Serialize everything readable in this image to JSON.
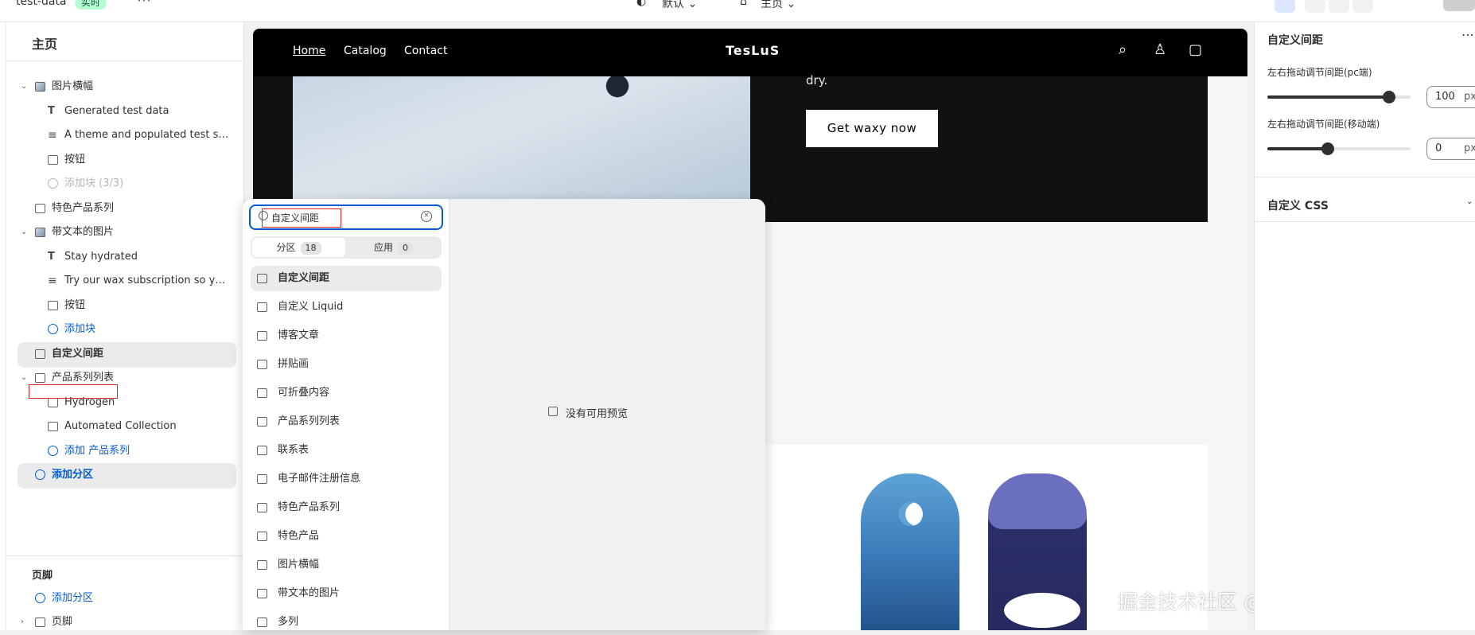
{
  "topbar": {
    "store_name": "test-data",
    "status_badge": "实时",
    "theme_selector": "默认",
    "page_selector": "主页"
  },
  "left_panel": {
    "title": "主页",
    "items": [
      {
        "label": "图片横幅",
        "icon": "image-icon",
        "level": 0,
        "chevron": true
      },
      {
        "label": "Generated test data",
        "icon": "text-icon",
        "level": 1
      },
      {
        "label": "A theme and populated test stor...",
        "icon": "lines-icon",
        "level": 1
      },
      {
        "label": "按钮",
        "icon": "button-icon",
        "level": 1
      },
      {
        "label": "添加块 (3/3)",
        "icon": "add-icon",
        "level": 1,
        "disabled": true
      },
      {
        "label": "特色产品系列",
        "icon": "section-icon",
        "level": 0
      },
      {
        "label": "带文本的图片",
        "icon": "image-icon",
        "level": 0,
        "chevron": true
      },
      {
        "label": "Stay hydrated",
        "icon": "text-icon",
        "level": 1
      },
      {
        "label": "Try our wax subscription so you...",
        "icon": "lines-icon",
        "level": 1
      },
      {
        "label": "按钮",
        "icon": "button-icon",
        "level": 1
      },
      {
        "label": "添加块",
        "icon": "add-icon",
        "level": 1,
        "blue": true
      },
      {
        "label": "自定义间距",
        "icon": "section-icon",
        "level": 0,
        "selected": true
      },
      {
        "label": "产品系列列表",
        "icon": "section-icon",
        "level": 0,
        "chevron": true
      },
      {
        "label": "Hydrogen",
        "icon": "frame-icon",
        "level": 1
      },
      {
        "label": "Automated Collection",
        "icon": "frame-icon",
        "level": 1
      },
      {
        "label": "添加 产品系列",
        "icon": "add-icon",
        "level": 1,
        "blue": true
      },
      {
        "label": "添加分区",
        "icon": "add-icon",
        "level": 0,
        "blue": true,
        "highlight": true
      }
    ],
    "footer_title": "页脚",
    "footer_add": "添加分区",
    "footer_item": "页脚"
  },
  "storefront": {
    "nav": [
      "Home",
      "Catalog",
      "Contact"
    ],
    "brand": "TesLuS",
    "hero_text": "dry.",
    "cta": "Get waxy now"
  },
  "picker": {
    "search_value": "自定义间距",
    "tabs": [
      {
        "label": "分区",
        "count": "18"
      },
      {
        "label": "应用",
        "count": "0"
      }
    ],
    "options": [
      "自定义间距",
      "自定义 Liquid",
      "博客文章",
      "拼贴画",
      "可折叠内容",
      "产品系列列表",
      "联系表",
      "电子邮件注册信息",
      "特色产品系列",
      "特色产品",
      "图片横幅",
      "带文本的图片",
      "多列"
    ],
    "no_preview": "没有可用预览"
  },
  "settings": {
    "title": "自定义间距",
    "pc_label": "左右拖动调节间距(pc端)",
    "pc_value": "100",
    "pc_fraction": 0.85,
    "mobile_label": "左右拖动调节间距(移动端)",
    "mobile_value": "0",
    "mobile_fraction": 0.42,
    "unit": "px",
    "css_title": "自定义 CSS"
  },
  "watermark": "掘金技术社区 @ Shpify二次开发_小海"
}
